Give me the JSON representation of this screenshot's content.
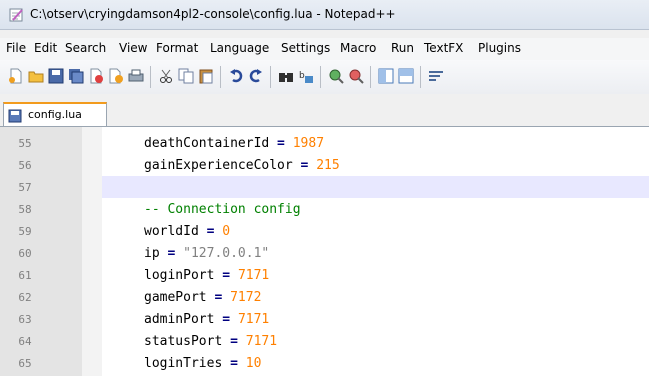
{
  "window": {
    "title": "C:\\otserv\\cryingdamson4pl2-console\\config.lua - Notepad++"
  },
  "menu": [
    "File",
    "Edit",
    "Search",
    "View",
    "Format",
    "Language",
    "Settings",
    "Macro",
    "Run",
    "TextFX",
    "Plugins"
  ],
  "toolbar": {
    "icons": [
      "new-file-icon",
      "open-file-icon",
      "save-icon",
      "save-all-icon",
      "close-icon",
      "close-all-icon",
      "print-icon",
      "cut-icon",
      "copy-icon",
      "paste-icon",
      "undo-icon",
      "redo-icon",
      "find-icon",
      "replace-icon",
      "zoom-in-icon",
      "zoom-out-icon",
      "sync-vertical-icon",
      "sync-horizontal-icon",
      "word-wrap-icon"
    ]
  },
  "tab": {
    "label": "config.lua"
  },
  "editor": {
    "current_line": "57",
    "lines": [
      {
        "num": "55",
        "key": "deathContainerId",
        "eq": " = ",
        "value": "1987",
        "type": "num"
      },
      {
        "num": "56",
        "key": "gainExperienceColor",
        "eq": " = ",
        "value": "215",
        "type": "num"
      },
      {
        "num": "57",
        "key": "",
        "eq": "",
        "value": "",
        "type": "blank"
      },
      {
        "num": "58",
        "key": "-- Connection config",
        "eq": "",
        "value": "",
        "type": "comment"
      },
      {
        "num": "59",
        "key": "worldId",
        "eq": " = ",
        "value": "0",
        "type": "num"
      },
      {
        "num": "60",
        "key": "ip",
        "eq": " = ",
        "value": "\"127.0.0.1\"",
        "type": "str"
      },
      {
        "num": "61",
        "key": "loginPort",
        "eq": " = ",
        "value": "7171",
        "type": "num"
      },
      {
        "num": "62",
        "key": "gamePort",
        "eq": " = ",
        "value": "7172",
        "type": "num"
      },
      {
        "num": "63",
        "key": "adminPort",
        "eq": " = ",
        "value": "7171",
        "type": "num"
      },
      {
        "num": "64",
        "key": "statusPort",
        "eq": " = ",
        "value": "7171",
        "type": "num"
      },
      {
        "num": "65",
        "key": "loginTries",
        "eq": " = ",
        "value": "10",
        "type": "num"
      }
    ]
  }
}
